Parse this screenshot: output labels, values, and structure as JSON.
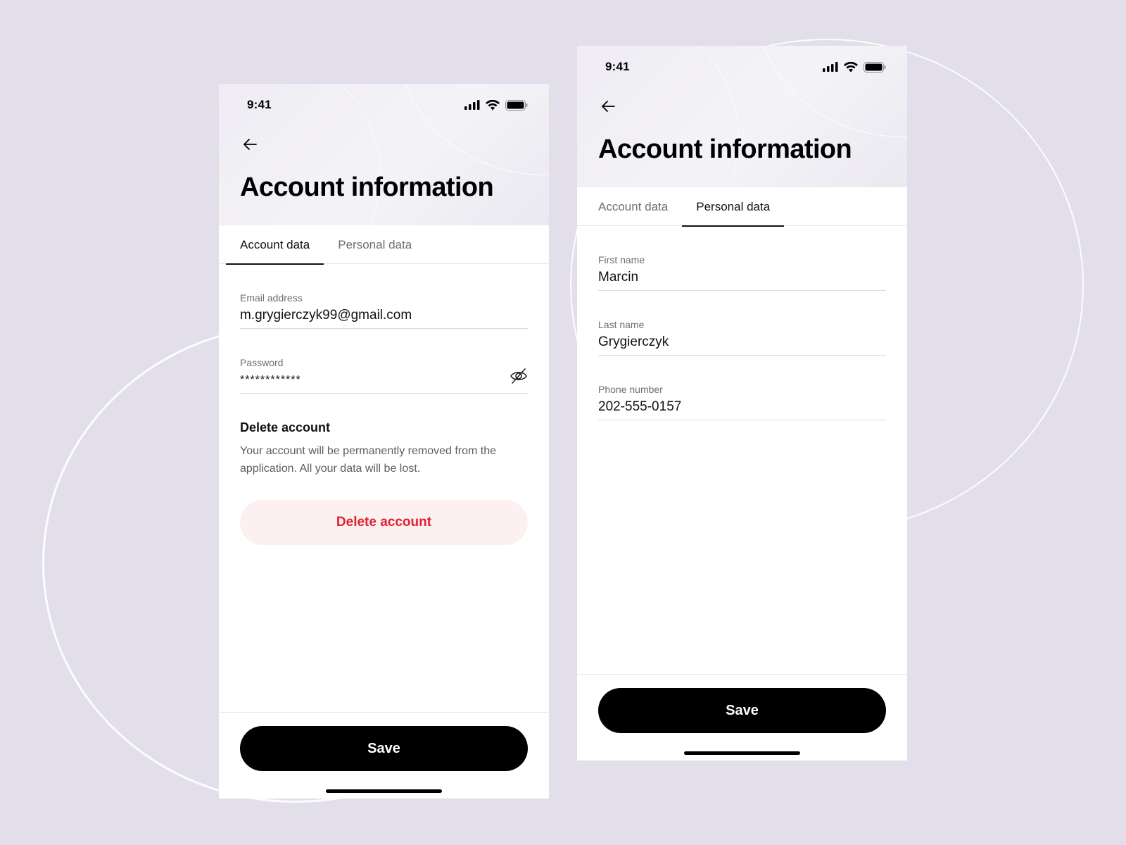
{
  "status_bar": {
    "time": "9:41"
  },
  "left_screen": {
    "title": "Account information",
    "tabs": [
      {
        "label": "Account data",
        "active": true
      },
      {
        "label": "Personal data",
        "active": false
      }
    ],
    "fields": {
      "email": {
        "label": "Email address",
        "value": "m.grygierczyk99@gmail.com"
      },
      "password": {
        "label": "Password",
        "value": "************"
      }
    },
    "delete_section": {
      "title": "Delete account",
      "description": "Your account will be permanently removed from the application. All your data will be lost.",
      "button_label": "Delete account"
    },
    "save_label": "Save"
  },
  "right_screen": {
    "title": "Account information",
    "tabs": [
      {
        "label": "Account data",
        "active": false
      },
      {
        "label": "Personal data",
        "active": true
      }
    ],
    "fields": {
      "first_name": {
        "label": "First name",
        "value": "Marcin"
      },
      "last_name": {
        "label": "Last name",
        "value": "Grygierczyk"
      },
      "phone": {
        "label": "Phone number",
        "value": "202-555-0157"
      }
    },
    "save_label": "Save"
  },
  "icons": {
    "back": "arrow-left-icon",
    "password_visibility": "eye-off-icon",
    "signal": "cellular-signal-icon",
    "wifi": "wifi-icon",
    "battery": "battery-icon"
  },
  "colors": {
    "background": "#e2dfea",
    "primary_button": "#000000",
    "danger_text": "#e0212f",
    "danger_bg": "#fdf0f1"
  }
}
